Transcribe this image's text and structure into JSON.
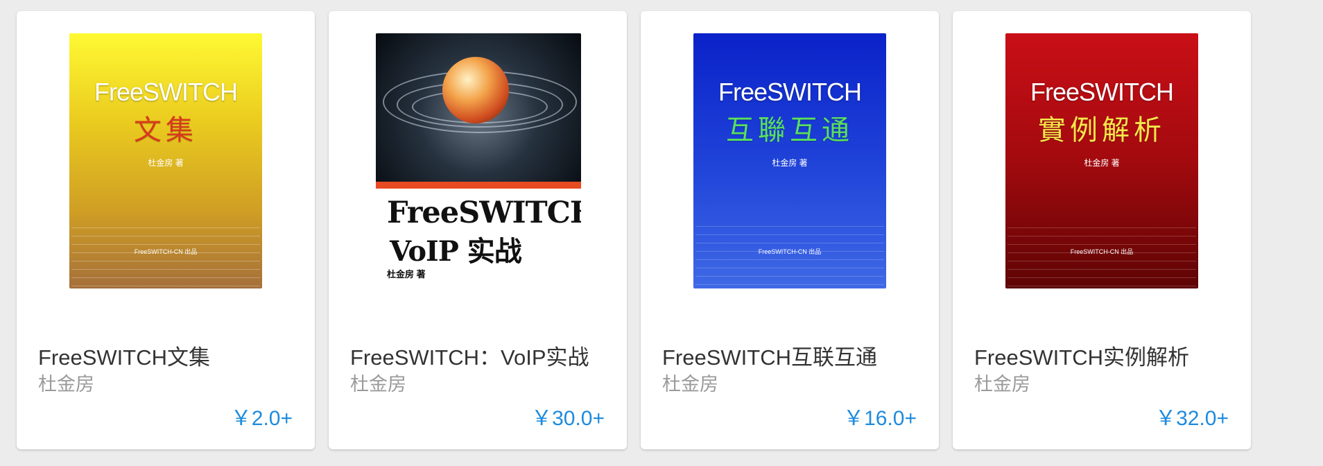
{
  "books": [
    {
      "title": "FreeSWITCH文集",
      "author": "杜金房",
      "price": "￥2.0+",
      "cover": {
        "title": "FreeSWITCH",
        "subtitle": "文集",
        "subtitle_color": "#d83a1a",
        "author": "杜金房 著",
        "footer": "FreeSWITCH-CN 出品"
      }
    },
    {
      "title": "FreeSWITCH：VoIP实战",
      "author": "杜金房",
      "price": "￥30.0+",
      "cover": {
        "title_line1": "FreeSWITCH",
        "title_line2": "VoIP 实战",
        "author": "杜金房 著",
        "accent": "#e84a22"
      }
    },
    {
      "title": "FreeSWITCH互联互通",
      "author": "杜金房",
      "price": "￥16.0+",
      "cover": {
        "title": "FreeSWITCH",
        "subtitle": "互聯互通",
        "subtitle_color": "#59e05d",
        "author": "杜金房 著",
        "footer": "FreeSWITCH-CN 出品"
      }
    },
    {
      "title": "FreeSWITCH实例解析",
      "author": "杜金房",
      "price": "￥32.0+",
      "cover": {
        "title": "FreeSWITCH",
        "subtitle": "實例解析",
        "subtitle_color": "#f5e84b",
        "author": "杜金房 著",
        "footer": "FreeSWITCH-CN 出品"
      }
    }
  ],
  "colors": {
    "background": "#ececec",
    "card": "#ffffff",
    "title": "#333333",
    "author": "#9a9a9a",
    "price": "#1e8bdd"
  }
}
